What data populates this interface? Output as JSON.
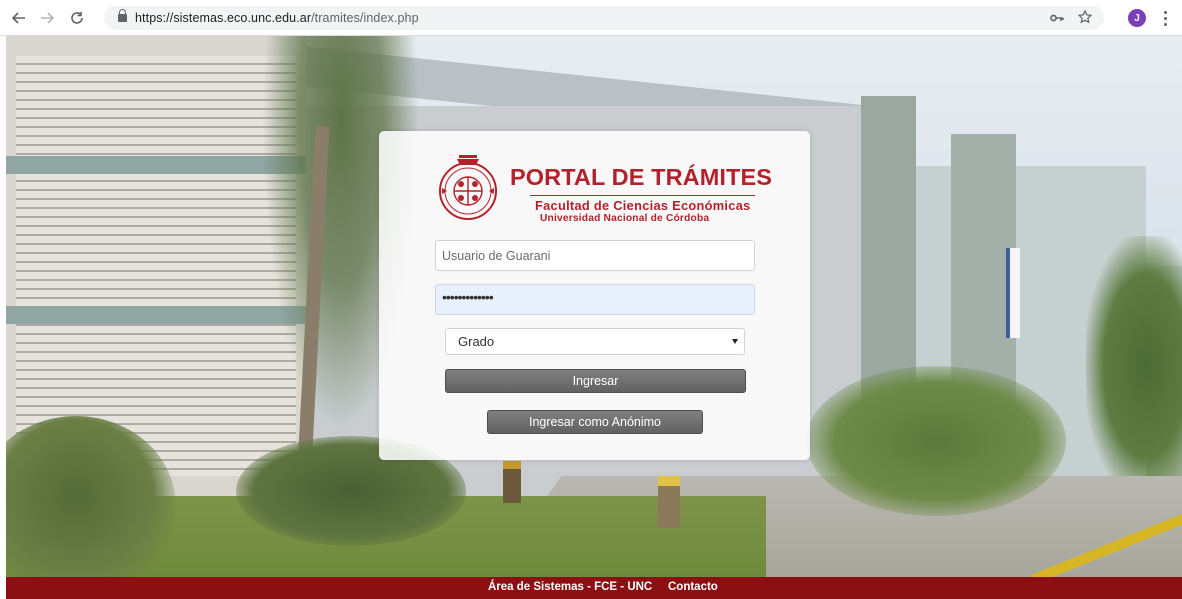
{
  "browser": {
    "url_scheme_host": "https://sistemas.eco.unc.edu.ar",
    "url_path": "/tramites/index.php",
    "profile_initial": "J",
    "icons": [
      "back-arrow-icon",
      "forward-arrow-icon",
      "reload-icon",
      "lock-icon",
      "key-icon",
      "star-icon",
      "kebab-menu-icon"
    ]
  },
  "logo": {
    "title": "PORTAL DE TRÁMITES",
    "subtitle": "Facultad de Ciencias Económicas",
    "subtitle2": "Universidad Nacional de Córdoba",
    "brand_color": "#b3222a"
  },
  "form": {
    "username_placeholder": "Usuario de Guarani",
    "password_value": "•••••••••••••",
    "select_value": "Grado",
    "login_label": "Ingresar",
    "anon_label": "Ingresar como Anónimo"
  },
  "footer": {
    "left_text": "Área de Sistemas - FCE - UNC",
    "right_text": "Contacto",
    "color": "#8b0f13"
  }
}
